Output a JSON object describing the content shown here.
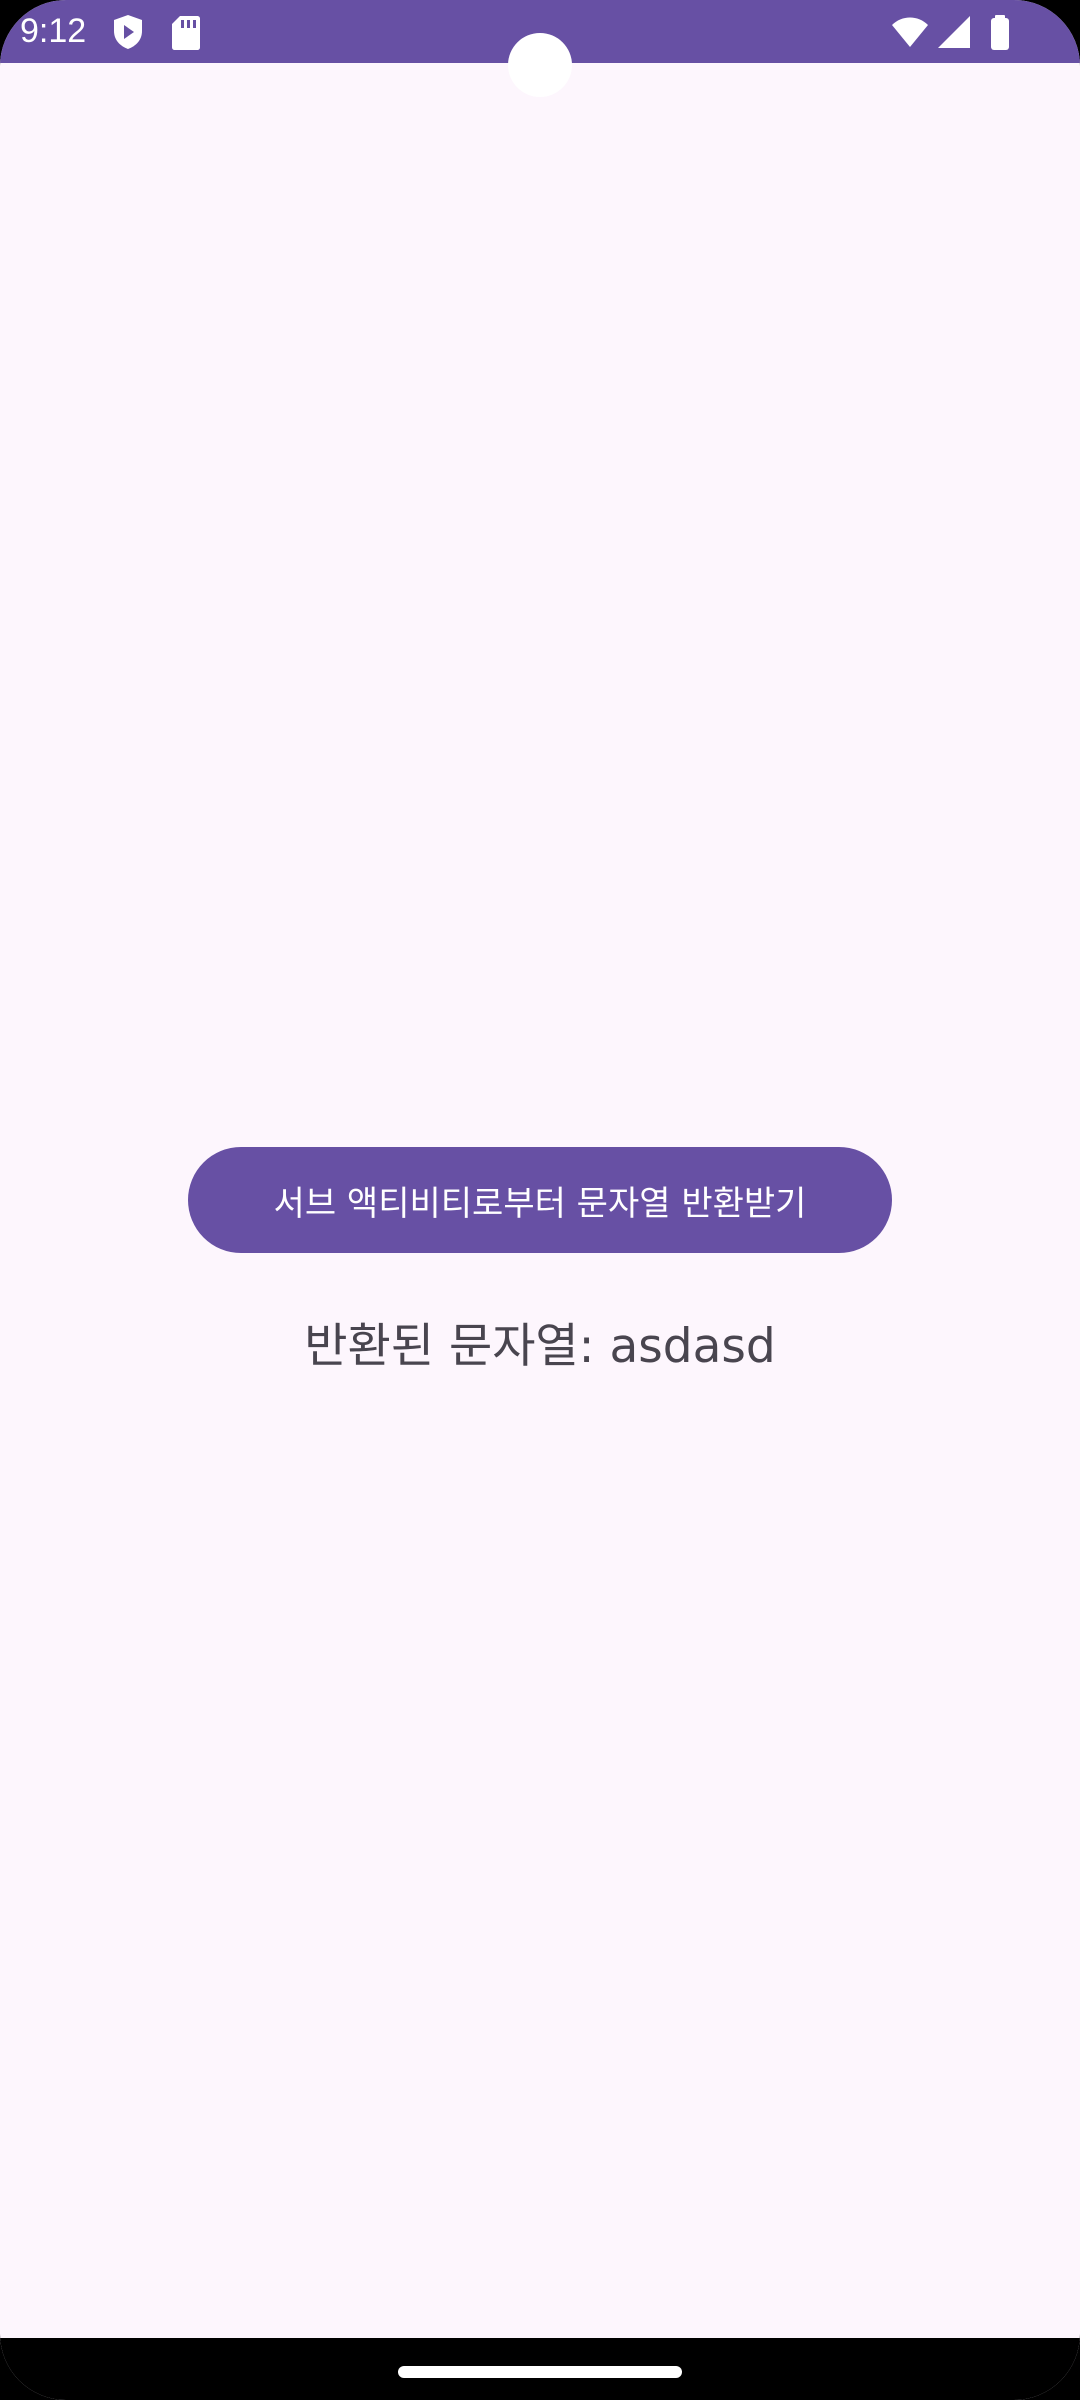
{
  "status_bar": {
    "time": "9:12",
    "icons": [
      "shield-play-icon",
      "sd-card-icon",
      "wifi-icon",
      "cell-signal-icon",
      "battery-icon"
    ],
    "background_color": "#6750a4"
  },
  "main": {
    "button_label": "서브 액티비티로부터 문자열 반환받기",
    "result_text": "반환된 문자열: asdasd",
    "background_color": "#fdf6fd",
    "accent_color": "#6750a4"
  }
}
